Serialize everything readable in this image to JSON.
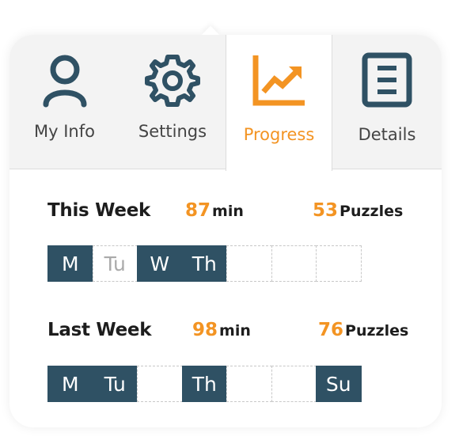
{
  "tabs": [
    {
      "label": "My Info",
      "icon": "user-icon",
      "active": false
    },
    {
      "label": "Settings",
      "icon": "gear-icon",
      "active": false
    },
    {
      "label": "Progress",
      "icon": "chart-icon",
      "active": true
    },
    {
      "label": "Details",
      "icon": "document-icon",
      "active": false
    }
  ],
  "colors": {
    "accent": "#f39423",
    "dark": "#2f5164",
    "icon": "#2f5164"
  },
  "this_week": {
    "title": "This Week",
    "minutes": "87",
    "minutes_unit": "min",
    "puzzles": "53",
    "puzzles_unit": "Puzzles",
    "days": [
      {
        "label": "M",
        "active": true
      },
      {
        "label": "Tu",
        "active": false
      },
      {
        "label": "W",
        "active": true
      },
      {
        "label": "Th",
        "active": true
      },
      {
        "label": "",
        "active": false
      },
      {
        "label": "",
        "active": false
      },
      {
        "label": "",
        "active": false
      }
    ]
  },
  "last_week": {
    "title": "Last Week",
    "minutes": "98",
    "minutes_unit": "min",
    "puzzles": "76",
    "puzzles_unit": "Puzzles",
    "days": [
      {
        "label": "M",
        "active": true
      },
      {
        "label": "Tu",
        "active": true
      },
      {
        "label": "",
        "active": false
      },
      {
        "label": "Th",
        "active": true
      },
      {
        "label": "",
        "active": false
      },
      {
        "label": "",
        "active": false
      },
      {
        "label": "Su",
        "active": true
      }
    ]
  }
}
